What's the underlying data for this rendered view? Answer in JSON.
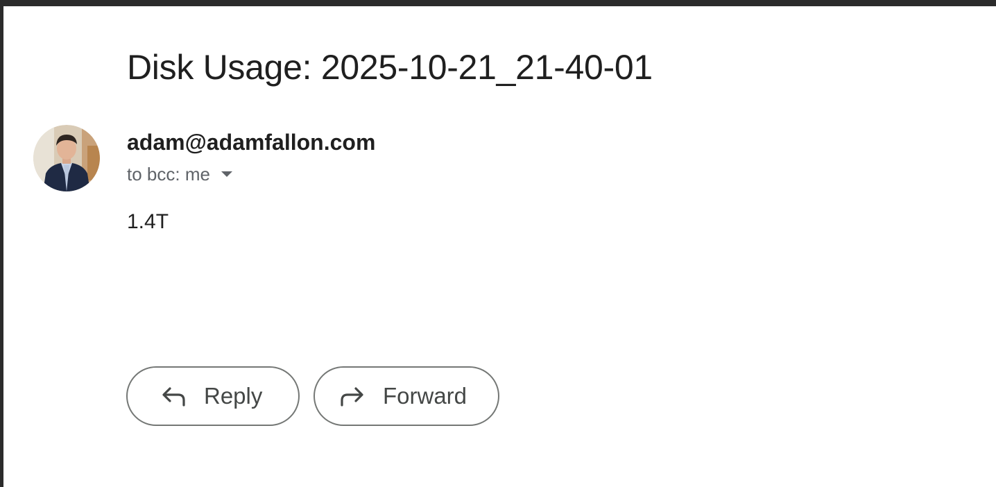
{
  "email": {
    "subject": "Disk Usage: 2025-10-21_21-40-01",
    "sender": "adam@adamfallon.com",
    "recipients": "to bcc: me",
    "body": "1.4T"
  },
  "actions": {
    "reply_label": "Reply",
    "forward_label": "Forward"
  },
  "icons": {
    "reply": "reply-icon",
    "forward": "forward-icon",
    "details": "chevron-down-icon"
  },
  "colors": {
    "text_primary": "#1f1f1f",
    "text_secondary": "#5f6368",
    "button_border": "#747775"
  }
}
